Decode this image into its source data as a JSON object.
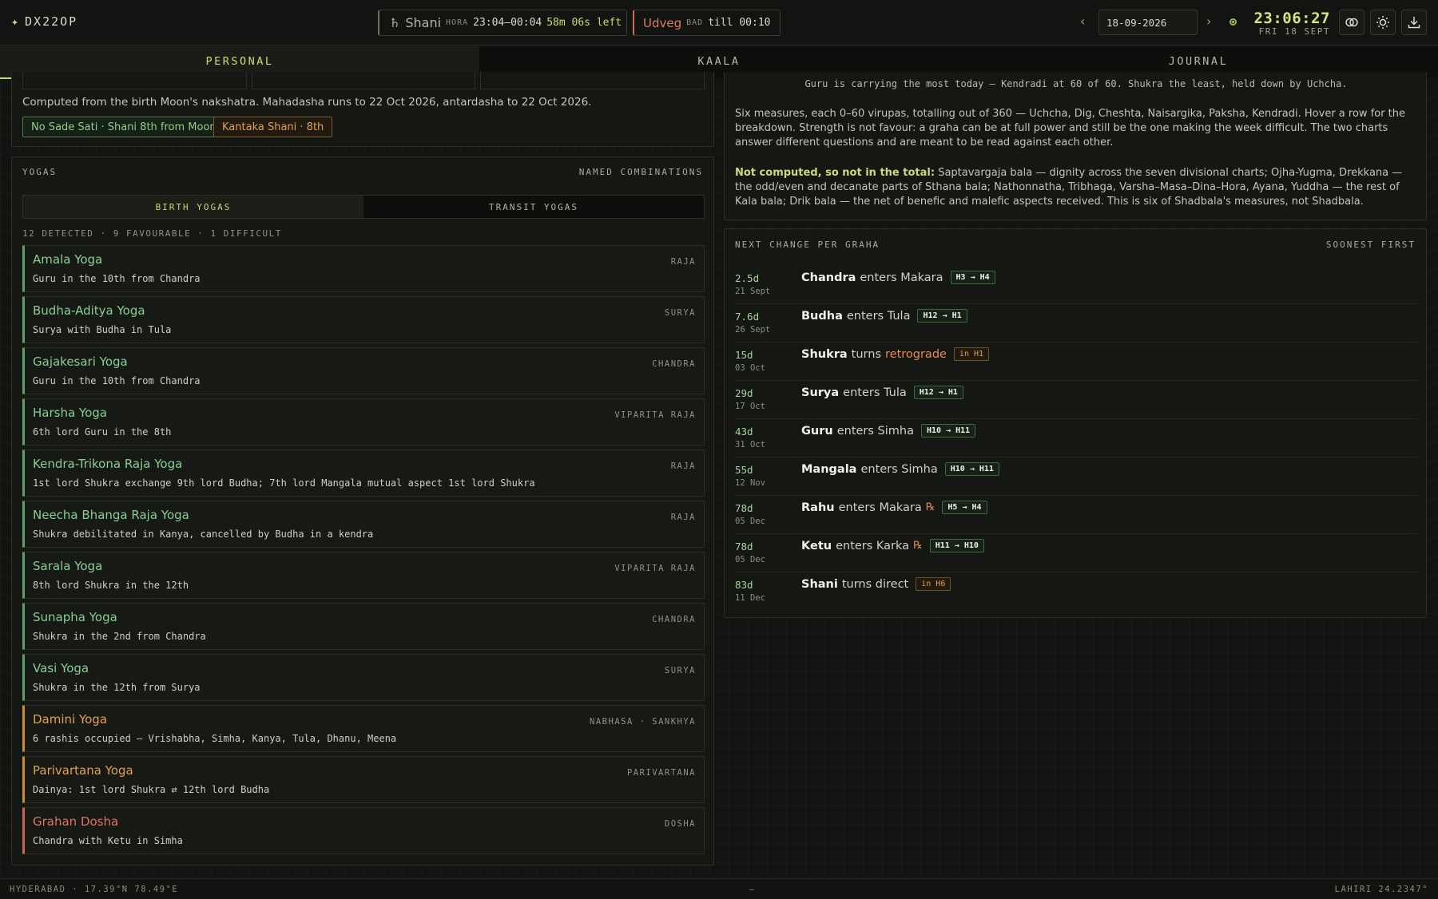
{
  "app": {
    "logo_glyph": "✦",
    "title": "DX22OP"
  },
  "hora": {
    "planet_glyph": "♄",
    "planet": "Shani",
    "label": "HORA",
    "range": "23:04–00:04",
    "remaining": "58m 06s left"
  },
  "choghadiya": {
    "name": "Udveg",
    "label": "BAD",
    "until": "till 00:10"
  },
  "date_nav": {
    "prev": "‹",
    "date": "18-09-2026",
    "next": "›"
  },
  "clock": {
    "time": "23:06:27",
    "day": "FRI 18 SEPT"
  },
  "tabs": [
    {
      "label": "PERSONAL",
      "active": true
    },
    {
      "label": "KAALA",
      "active": false
    },
    {
      "label": "JOURNAL",
      "active": false
    }
  ],
  "dasha": {
    "note": "Computed from the birth Moon's nakshatra. Mahadasha runs to 22 Oct 2026, antardasha to 22 Oct 2026.",
    "badges": [
      "No Sade Sati · Shani 8th from Moon",
      "Kantaka Shani · 8th"
    ]
  },
  "yogas": {
    "title": "YOGAS",
    "subtitle": "NAMED COMBINATIONS",
    "subtabs": [
      "BIRTH YOGAS",
      "TRANSIT YOGAS"
    ],
    "count": "12 DETECTED · 9 FAVOURABLE · 1 DIFFICULT",
    "items": [
      {
        "name": "Amala Yoga",
        "desc": "Guru in the 10th from Chandra",
        "type": "RAJA",
        "tone": "good"
      },
      {
        "name": "Budha-Aditya Yoga",
        "desc": "Surya with Budha in Tula",
        "type": "SURYA",
        "tone": "good"
      },
      {
        "name": "Gajakesari Yoga",
        "desc": "Guru in the 10th from Chandra",
        "type": "CHANDRA",
        "tone": "good"
      },
      {
        "name": "Harsha Yoga",
        "desc": "6th lord Guru in the 8th",
        "type": "VIPARITA RAJA",
        "tone": "good"
      },
      {
        "name": "Kendra-Trikona Raja Yoga",
        "desc": "1st lord Shukra exchange 9th lord Budha; 7th lord Mangala mutual aspect 1st lord Shukra",
        "type": "RAJA",
        "tone": "good"
      },
      {
        "name": "Neecha Bhanga Raja Yoga",
        "desc": "Shukra debilitated in Kanya, cancelled by Budha in a kendra",
        "type": "RAJA",
        "tone": "good"
      },
      {
        "name": "Sarala Yoga",
        "desc": "8th lord Shukra in the 12th",
        "type": "VIPARITA RAJA",
        "tone": "good"
      },
      {
        "name": "Sunapha Yoga",
        "desc": "Shukra in the 2nd from Chandra",
        "type": "CHANDRA",
        "tone": "good"
      },
      {
        "name": "Vasi Yoga",
        "desc": "Shukra in the 12th from Surya",
        "type": "SURYA",
        "tone": "good"
      },
      {
        "name": "Damini Yoga",
        "desc": "6 rashis occupied — Vrishabha, Simha, Kanya, Tula, Dhanu, Meena",
        "type": "NABHASA · SANKHYA",
        "tone": "warn"
      },
      {
        "name": "Parivartana Yoga",
        "desc": "Dainya: 1st lord Shukra ⇄ 12th lord Budha",
        "type": "PARIVARTANA",
        "tone": "warn"
      },
      {
        "name": "Grahan Dosha",
        "desc": "Chandra with Ketu in Simha",
        "type": "DOSHA",
        "tone": "bad"
      }
    ]
  },
  "shadbala": {
    "summary": "Guru is carrying the most today — Kendradi at 60 of 60. Shukra the least, held down by Uchcha.",
    "para1": "Six measures, each 0–60 virupas, totalling out of 360 — Uchcha, Dig, Cheshta, Naisargika, Paksha, Kendradi. Hover a row for the breakdown. Strength is not favour: a graha can be at full power and still be the one making the week difficult. The two charts answer different questions and are meant to be read against each other.",
    "para2_label": "Not computed, so not in the total:",
    "para2": " Saptavargaja bala — dignity across the seven divisional charts; Ojha-Yugma, Drekkana — the odd/even and decanate parts of Sthana bala; Nathonnatha, Tribhaga, Varsha–Masa–Dina–Hora, Ayana, Yuddha — the rest of Kala bala; Drik bala — the net of benefic and malefic aspects received. This is six of Shadbala's measures, not Shadbala."
  },
  "next_change": {
    "title": "NEXT CHANGE PER GRAHA",
    "subtitle": "SOONEST FIRST",
    "items": [
      {
        "days": "2.5d",
        "date": "21 Sept",
        "graha": "Chandra",
        "verb": "enters Makara",
        "retro_mark": "",
        "tag": "H3 → H4",
        "tag_tone": "g"
      },
      {
        "days": "7.6d",
        "date": "26 Sept",
        "graha": "Budha",
        "verb": "enters Tula",
        "retro_mark": "",
        "tag": "H12 → H1",
        "tag_tone": "g"
      },
      {
        "days": "15d",
        "date": "03 Oct",
        "graha": "Shukra",
        "verb": "turns",
        "extra": "retrograde",
        "retro_mark": "",
        "tag": "in H1",
        "tag_tone": "o"
      },
      {
        "days": "29d",
        "date": "17 Oct",
        "graha": "Surya",
        "verb": "enters Tula",
        "retro_mark": "",
        "tag": "H12 → H1",
        "tag_tone": "g"
      },
      {
        "days": "43d",
        "date": "31 Oct",
        "graha": "Guru",
        "verb": "enters Simha",
        "retro_mark": "",
        "tag": "H10 → H11",
        "tag_tone": "g"
      },
      {
        "days": "55d",
        "date": "12 Nov",
        "graha": "Mangala",
        "verb": "enters Simha",
        "retro_mark": "",
        "tag": "H10 → H11",
        "tag_tone": "g"
      },
      {
        "days": "78d",
        "date": "05 Dec",
        "graha": "Rahu",
        "verb": "enters Makara",
        "retro_mark": "℞",
        "tag": "H5 → H4",
        "tag_tone": "g"
      },
      {
        "days": "78d",
        "date": "05 Dec",
        "graha": "Ketu",
        "verb": "enters Karka",
        "retro_mark": "℞",
        "tag": "H11 → H10",
        "tag_tone": "g"
      },
      {
        "days": "83d",
        "date": "11 Dec",
        "graha": "Shani",
        "verb": "turns direct",
        "retro_mark": "",
        "tag": "in H6",
        "tag_tone": "o"
      }
    ]
  },
  "footer": {
    "location": "HYDERABAD · 17.39°N 78.49°E",
    "center": "—",
    "ayanamsa": "LAHIRI 24.2347°"
  },
  "colors": {
    "accent": "#c9dc72",
    "good": "#86cf94",
    "warn": "#e3a04f",
    "bad": "#e07566"
  },
  "icons": {
    "live": "live-dot-icon",
    "theme": "eye-icon",
    "settings": "sun-icon",
    "download": "download-icon"
  }
}
